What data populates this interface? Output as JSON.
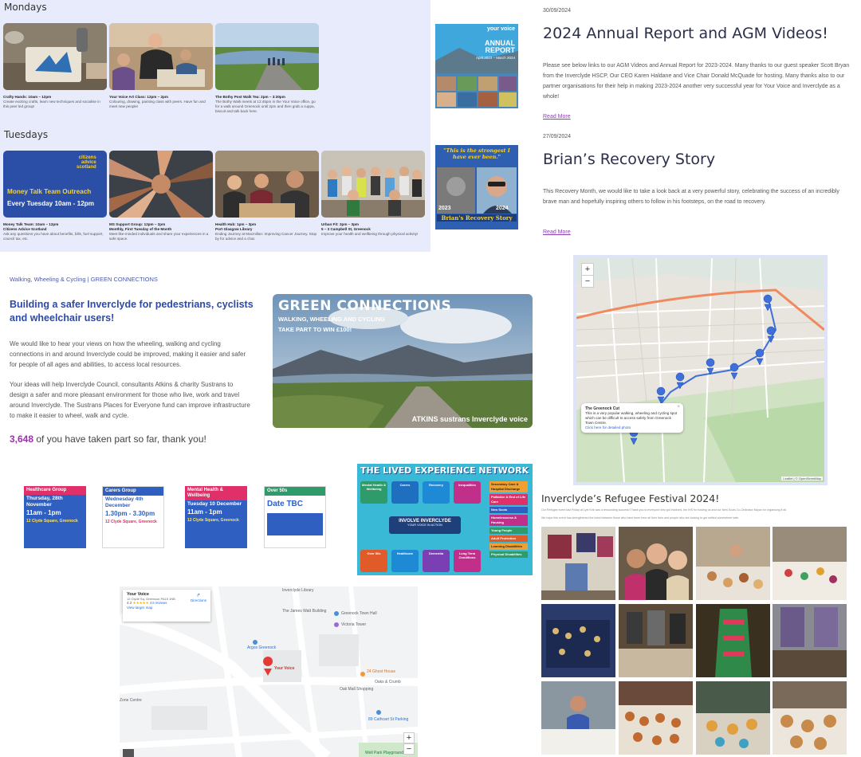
{
  "activities": {
    "days": [
      "Mondays",
      "Tuesdays"
    ],
    "monday": [
      {
        "title": "Crafty Hands: 10am – 12pm",
        "desc": "Create exciting crafts, learn new techniques and socialise in this peer led group!"
      },
      {
        "title": "Your Voice Art Class: 12pm – 2pm",
        "desc": "Colouring, drawing, painting class with peers. Have fun and meet new people!"
      },
      {
        "title": "The Bothy Post Walk Tea: 2pm – 3:30pm",
        "desc": "The Bothy Walk meets at 12:45pm in the Your Voice office, go for a walk around Greenock until 2pm and then grab a cuppa, biscuit and talk back here."
      }
    ],
    "tuesday": [
      {
        "title": "Money Talk Team: 10am – 12pm",
        "sub": "Citizens Advice Scotland",
        "desc": "Ask any questions you have about benefits, bills, fuel support, council tax, etc."
      },
      {
        "title": "MS Support Group: 12pm – 2pm",
        "sub": "Monthly, First Tuesday of the Month",
        "desc": "Meet like-minded individuals and share your experiences in a safe space."
      },
      {
        "title": "Health Hub: 1pm – 3pm",
        "sub": "Port Glasgow Library",
        "desc": "Ending Journey at Macmillan: Improving Cancer Journey. Stop by for advice and a chat."
      },
      {
        "title": "Urban Fit: 2pm – 3pm",
        "sub": "5 – 3 Campbell St, Greenock",
        "desc": "Improve your health and wellbeing through physical activity!"
      }
    ],
    "cas_logo": [
      "citizens",
      "advice",
      "scotland"
    ],
    "cas_banner": [
      "Money Talk Team Outreach",
      "Every Tuesday 10am - 12pm"
    ]
  },
  "news": [
    {
      "date": "30/09/2024",
      "title": "2024 Annual Report and AGM Videos!",
      "body": "Please see below links to our AGM Videos and Annual Report for 2023-2024. Many thanks to our guest speaker Scott Bryan from the Inverclyde HSCP, Our CEO Karen Haldane and Vice Chair Donald McQuade for hosting. Many thanks also to our partner organisations for their help in making 2023-2024 another very successful year for Your Voice and Inverclyde as a whole!",
      "more": "Read More",
      "thumb": {
        "brand": "your voice",
        "line1": "ANNUAL",
        "line2": "REPORT",
        "line3": "April 2023 – March 2024"
      }
    },
    {
      "date": "27/09/2024",
      "title": "Brian’s Recovery Story",
      "body": "This Recovery Month, we would like to take a look back at a very powerful story, celebrating the success of an incredibly brave man and hopefully inspiring others to follow in his footsteps, on the road to recovery.",
      "more": "Read More",
      "thumb": {
        "quote": "\"This is the strongest I have ever been.\"",
        "y1": "2023",
        "y2": "2024",
        "caption": "Brian's Recovery Story"
      }
    }
  ],
  "green": {
    "crumb": "Walking, Wheeling & Cycling | GREEN CONNECTIONS",
    "heading": "Building a safer Inverclyde for pedestrians, cyclists and wheelchair users!",
    "p1": "We would like to hear your views on how the wheeling, walking and cycling connections in and around Inverclyde could be improved, making it easier and safer for people of all ages and abilities, to access local resources.",
    "p2": "Your ideas will help Inverclyde Council, consultants Atkins & charity Sustrans to design a safer and more pleasant environment for those who live, work and travel around Inverclyde. The Sustrans Places for Everyone fund can improve infrastructure to make it easier to wheel, walk and cycle.",
    "count": "3,648",
    "count_suffix": " of you have taken part so far, thank you!",
    "banner": {
      "title": "GREEN CONNECTIONS",
      "sub": "WALKING, WHEELING AND CYCLING",
      "prize": "TAKE PART TO WIN £100!",
      "logos": "ATKINS  sustrans  Inverclyde  voice"
    }
  },
  "posters": [
    {
      "head": "Healthcare Group",
      "date": "Thursday, 28th November",
      "time": "11am - 1pm",
      "place": "12 Clyde Square, Greenock",
      "color": "#e0306a"
    },
    {
      "head": "Carers Group",
      "date": "Wednesday 4th December",
      "time": "1.30pm - 3.30pm",
      "place": "12 Clyde Square, Greenock",
      "color": "#2f5fc0"
    },
    {
      "head": "Mental Health & Wellbeing",
      "date": "Tuesday 10 December",
      "time": "11am - 1pm",
      "place": "12 Clyde Square, Greenock",
      "color": "#e0306a"
    },
    {
      "head": "Over 50s",
      "date": "Date TBC",
      "time": "",
      "place": "",
      "color": "#2f5fc0"
    }
  ],
  "lived": {
    "title": "THE LIVED EXPERIENCE NETWORK",
    "boxes": [
      "Mental Health & Wellbeing",
      "Carers",
      "Recovery",
      "Inequalities",
      "Over 50s",
      "Healthcare",
      "Dementia",
      "Long Term Conditions"
    ],
    "center": "INVOLVE INVERCLYDE",
    "center_sub": "YOUR VOICE IN ACTION",
    "side": [
      "Secondary Care & Hospital Discharge",
      "Palliative & End of Life Care",
      "New Scots",
      "Homelessness & Housing",
      "Young People",
      "Adult Protection",
      "Learning Disabilities",
      "Physical Disabilities"
    ]
  },
  "map1": {
    "popup_title": "The Greenock Cut",
    "popup_body": "This is a very popular walking, wheeling and cycling spot which can be difficult to access safely from Greenock Town Centre.",
    "popup_link": "Click here for detailed photo",
    "zoom_in": "+",
    "zoom_out": "−",
    "attribution": "Leaflet | © OpenStreetMap"
  },
  "map2": {
    "place": "Your Voice",
    "address": "12 Clyde Sq, Greenock PA15 1NB",
    "rating": "4.2",
    "stars": "★★★★★",
    "reviews": "44 reviews",
    "larger": "View larger map",
    "directions": "Directions",
    "labels": [
      "The James Watt Building",
      "Greenock Town Hall",
      "Victoria Tower",
      "Argos Greenock",
      "Your Voice",
      "24 Ghost House",
      "Oaks & Crumb",
      "Oak Mall Shopping",
      "Zone Centre",
      "Well Park Playground",
      "89 Cathcart St Parking",
      "Inverclyde Library"
    ],
    "zoom_in": "+",
    "zoom_out": "−"
  },
  "refugee": {
    "title": "Inverclyde’s Refugee Festival 2024!",
    "p1": "Our Refugee event last Friday at Lyle Kirk was a resounding success! Thank you to everyone who got involved, the IHS for hosting us and our New Scots Co-Ordinator Bayan for organising it all.",
    "p2": "We hope this event has strengthened the bond between those who have been here all their lives and people who are looking to get settled somewhere safe."
  }
}
